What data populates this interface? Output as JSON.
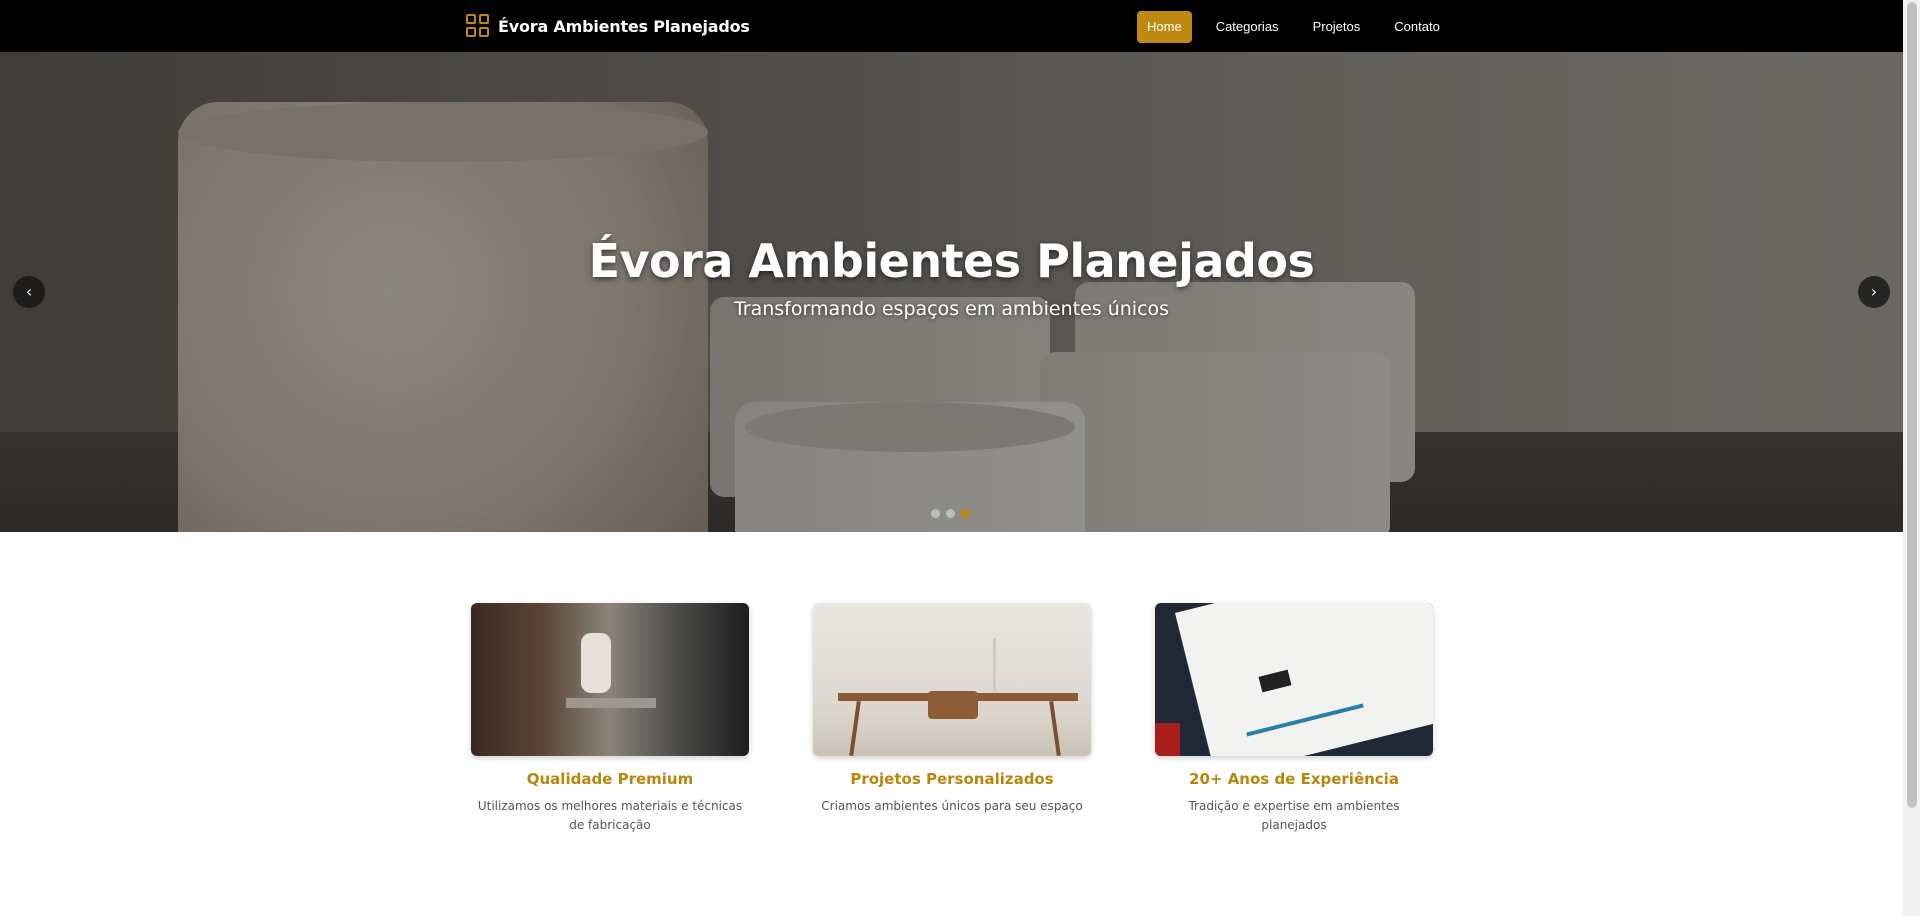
{
  "navbar": {
    "brand": "Évora Ambientes Planejados",
    "links": [
      "Home",
      "Categorias",
      "Projetos",
      "Contato"
    ],
    "active": "Home"
  },
  "hero": {
    "title": "Évora Ambientes Planejados",
    "subtitle": "Transformando espaços em ambientes únicos",
    "prev_icon": "chevron-left-icon",
    "next_icon": "chevron-right-icon",
    "slide_count": 3,
    "active_slide": 3
  },
  "features": [
    {
      "title": "Qualidade Premium",
      "text": "Utilizamos os melhores materiais e técnicas de fabricação"
    },
    {
      "title": "Projetos Personalizados",
      "text": "Criamos ambientes únicos para seu espaço"
    },
    {
      "title": "20+ Anos de Experiência",
      "text": "Tradição e expertise em ambientes planejados"
    }
  ],
  "colors": {
    "accent": "#c08a12",
    "nav_bg": "#000000",
    "title": "#b8860b"
  }
}
